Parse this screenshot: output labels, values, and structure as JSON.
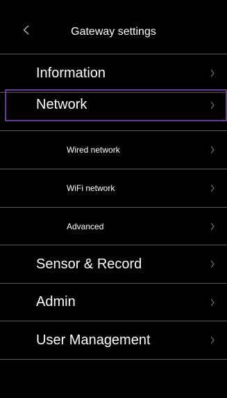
{
  "header": {
    "title": "Gateway settings",
    "back_icon": "chevron-left-icon"
  },
  "menu": {
    "items": [
      {
        "label": "Information",
        "level": "main",
        "icon": "chevron-right-icon"
      },
      {
        "label": "Network",
        "level": "main",
        "icon": "chevron-right-icon",
        "selected": true
      },
      {
        "label": "Wired network",
        "level": "sub",
        "icon": "chevron-right-icon"
      },
      {
        "label": "WiFi network",
        "level": "sub",
        "icon": "chevron-right-icon"
      },
      {
        "label": "Advanced",
        "level": "sub",
        "icon": "chevron-right-icon"
      },
      {
        "label": "Sensor & Record",
        "level": "main",
        "icon": "chevron-right-icon"
      },
      {
        "label": "Admin",
        "level": "main",
        "icon": "chevron-right-icon"
      },
      {
        "label": "User Management",
        "level": "main",
        "icon": "chevron-right-icon"
      }
    ]
  },
  "colors": {
    "background": "#000000",
    "text": "#ffffff",
    "divider": "#5a5a5a",
    "chevron": "#8a8a8a",
    "selection_outline": "#6b35a0"
  }
}
